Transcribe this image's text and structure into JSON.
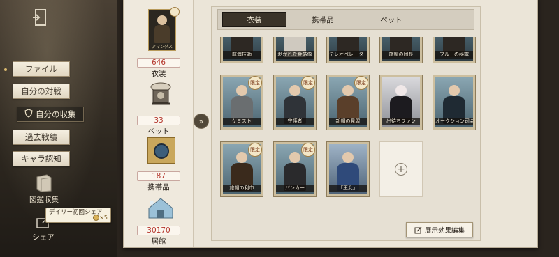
{
  "sidebar": {
    "items": [
      {
        "label": "ファイル",
        "active": false
      },
      {
        "label": "自分の対戦",
        "active": false
      },
      {
        "label": "自分の収集",
        "active": true
      },
      {
        "label": "過去戦績",
        "active": false
      },
      {
        "label": "キャラ認知",
        "active": false
      }
    ],
    "tools": {
      "codex_label": "図鑑収集",
      "share_label": "シェア"
    },
    "tooltip": "デイリー初回シェア",
    "tooltip_reward": "×5"
  },
  "stats": {
    "costume": {
      "count": "646",
      "label": "衣装",
      "card_name": "アマンダス"
    },
    "pet": {
      "count": "33",
      "label": "ペット"
    },
    "accessory": {
      "count": "187",
      "label": "携帯品"
    },
    "residence": {
      "count": "30170",
      "label": "居館"
    }
  },
  "tabs": [
    {
      "label": "衣装",
      "active": true
    },
    {
      "label": "携帯品",
      "active": false
    },
    {
      "label": "ペット",
      "active": false
    }
  ],
  "cards_partial_row": [
    {
      "name": "航海技師",
      "badge": ""
    },
    {
      "name": "剥がれた金箔像",
      "badge": ""
    },
    {
      "name": "テレオペレーター",
      "badge": ""
    },
    {
      "name": "旅帽の団長",
      "badge": ""
    },
    {
      "name": "ブルーの秘露",
      "badge": ""
    }
  ],
  "cards_row2": [
    {
      "name": "ケミスト",
      "badge": "限定"
    },
    {
      "name": "守護者",
      "badge": "限定"
    },
    {
      "name": "新帽の見習",
      "badge": "限定"
    },
    {
      "name": "出待ちファン",
      "badge": ""
    },
    {
      "name": "オークション司会",
      "badge": ""
    }
  ],
  "cards_row3": [
    {
      "name": "旅帽の利市",
      "badge": "限定"
    },
    {
      "name": "バンカー",
      "badge": "限定"
    },
    {
      "name": "「王女」",
      "badge": ""
    }
  ],
  "edit_button": "展示効果編集",
  "colors": {
    "accent_red": "#b4342a",
    "dark_tab": "#3a3329",
    "page_bg": "#ebe5d8"
  }
}
